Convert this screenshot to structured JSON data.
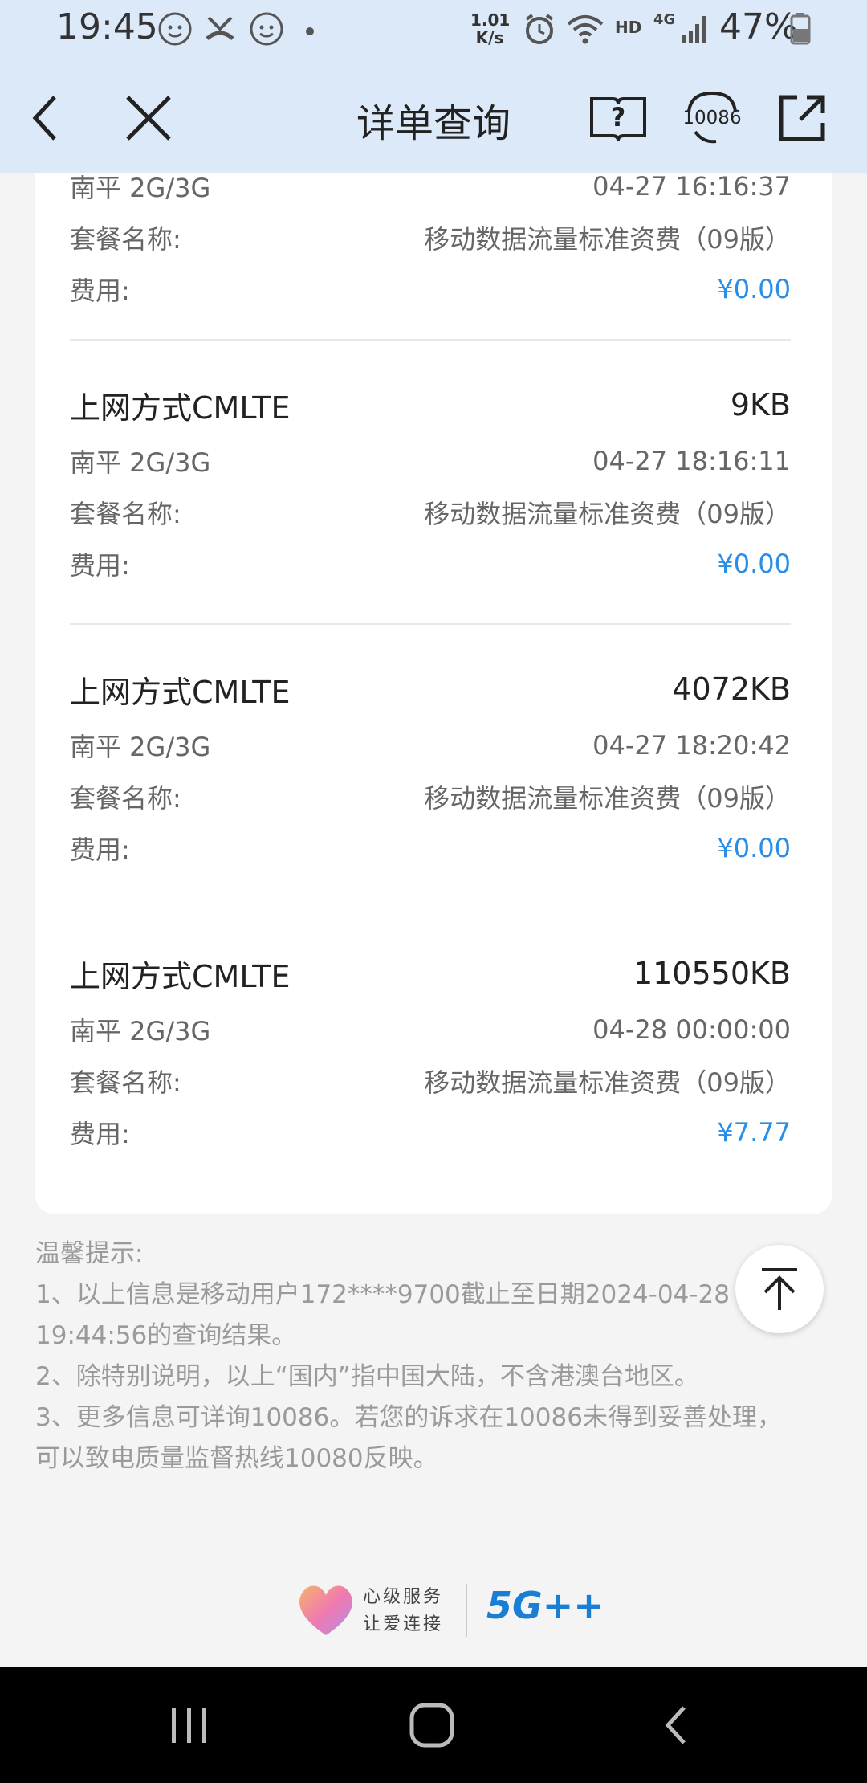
{
  "status": {
    "time": "19:45",
    "net_speed_top": "1.01",
    "net_speed_bottom": "K/s",
    "hd": "HD",
    "net_type": "4G",
    "battery_percent": "47%"
  },
  "header": {
    "title": "详单查询",
    "service_number": "10086"
  },
  "records": [
    {
      "partial": true,
      "location": "南平 2G/3G",
      "time": "04-27 16:16:37",
      "package_label": "套餐名称:",
      "package": "移动数据流量标准资费（09版）",
      "fee_label": "费用:",
      "fee": "¥0.00"
    },
    {
      "type": "上网方式CMLTE",
      "amount": "9KB",
      "location": "南平 2G/3G",
      "time": "04-27 18:16:11",
      "package_label": "套餐名称:",
      "package": "移动数据流量标准资费（09版）",
      "fee_label": "费用:",
      "fee": "¥0.00"
    },
    {
      "type": "上网方式CMLTE",
      "amount": "4072KB",
      "location": "南平 2G/3G",
      "time": "04-27 18:20:42",
      "package_label": "套餐名称:",
      "package": "移动数据流量标准资费（09版）",
      "fee_label": "费用:",
      "fee": "¥0.00"
    },
    {
      "type": "上网方式CMLTE",
      "amount": "110550KB",
      "location": "南平 2G/3G",
      "time": "04-28 00:00:00",
      "package_label": "套餐名称:",
      "package": "移动数据流量标准资费（09版）",
      "fee_label": "费用:",
      "fee": "¥7.77"
    }
  ],
  "tips": {
    "title": "温馨提示:",
    "line1a": "1、以上信息是移动用户172****9700截止至日期2024-04-28",
    "line1b": "19:44:56的查询结果。",
    "line2": "2、除特别说明，以上“国内”指中国大陆，不含港澳台地区。",
    "line3a": "3、更多信息可详询10086。若您的诉求在10086未得到妥善处理，",
    "line3b": "可以致电质量监督热线10080反映。"
  },
  "footer": {
    "slogan_line1": "心级服务",
    "slogan_line2": "让爱连接",
    "brand": "5G++"
  },
  "colors": {
    "header_bg": "#dbe9f8",
    "fee_blue": "#2a8de6",
    "page_bg": "#f4f4f4"
  }
}
